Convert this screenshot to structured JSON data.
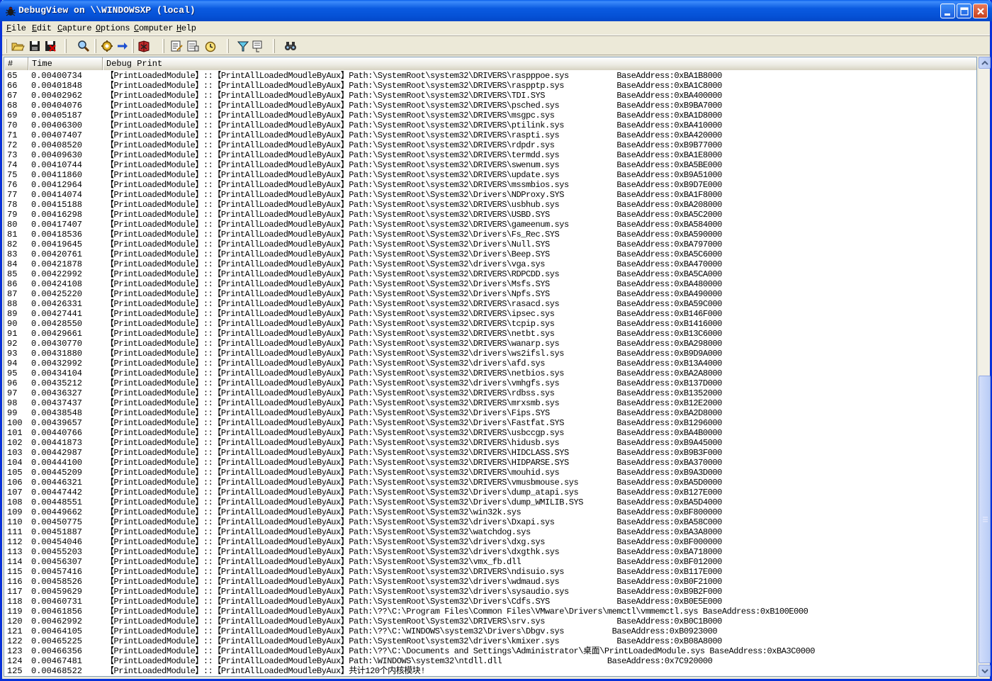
{
  "window": {
    "title": "DebugView on \\\\WINDOWSXP (local)"
  },
  "menu": {
    "items": [
      {
        "label": "File",
        "accel": "F",
        "rest": "ile"
      },
      {
        "label": "Edit",
        "accel": "E",
        "rest": "dit"
      },
      {
        "label": "Capture",
        "accel": "C",
        "rest": "apture"
      },
      {
        "label": "Options",
        "accel": "O",
        "rest": "ptions"
      },
      {
        "label": "Computer",
        "accel": "C",
        "rest": "omputer"
      },
      {
        "label": "Help",
        "accel": "H",
        "rest": "elp"
      }
    ]
  },
  "toolbar": {
    "icons": [
      "open-folder-icon",
      "save-icon",
      "save-red-icon",
      "find-icon",
      "capture-gear-icon",
      "forward-arrow-icon",
      "clear-book-icon",
      "edit-filter-icon",
      "properties-icon",
      "clock-icon",
      "filter-highlight-icon",
      "highlight-icon",
      "binoculars-icon"
    ]
  },
  "columns": {
    "num": "#",
    "time": "Time",
    "msg": "Debug Print"
  },
  "rows": [
    {
      "n": "65",
      "t": "0.00400734",
      "m": "【PrintLoadedModule】::【PrintAllLoadedMoudleByAux】Path:\\SystemRoot\\system32\\DRIVERS\\raspppoe.sys          BaseAddress:0xBA1B8000"
    },
    {
      "n": "66",
      "t": "0.00401848",
      "m": "【PrintLoadedModule】::【PrintAllLoadedMoudleByAux】Path:\\SystemRoot\\system32\\DRIVERS\\raspptp.sys           BaseAddress:0xBA1C8000"
    },
    {
      "n": "67",
      "t": "0.00402962",
      "m": "【PrintLoadedModule】::【PrintAllLoadedMoudleByAux】Path:\\SystemRoot\\system32\\DRIVERS\\TDI.SYS               BaseAddress:0xBA400000"
    },
    {
      "n": "68",
      "t": "0.00404076",
      "m": "【PrintLoadedModule】::【PrintAllLoadedMoudleByAux】Path:\\SystemRoot\\system32\\DRIVERS\\psched.sys            BaseAddress:0xB9BA7000"
    },
    {
      "n": "69",
      "t": "0.00405187",
      "m": "【PrintLoadedModule】::【PrintAllLoadedMoudleByAux】Path:\\SystemRoot\\system32\\DRIVERS\\msgpc.sys             BaseAddress:0xBA1D8000"
    },
    {
      "n": "70",
      "t": "0.00406300",
      "m": "【PrintLoadedModule】::【PrintAllLoadedMoudleByAux】Path:\\SystemRoot\\system32\\DRIVERS\\ptilink.sys           BaseAddress:0xBA410000"
    },
    {
      "n": "71",
      "t": "0.00407407",
      "m": "【PrintLoadedModule】::【PrintAllLoadedMoudleByAux】Path:\\SystemRoot\\system32\\DRIVERS\\raspti.sys            BaseAddress:0xBA420000"
    },
    {
      "n": "72",
      "t": "0.00408520",
      "m": "【PrintLoadedModule】::【PrintAllLoadedMoudleByAux】Path:\\SystemRoot\\system32\\DRIVERS\\rdpdr.sys             BaseAddress:0xB9B77000"
    },
    {
      "n": "73",
      "t": "0.00409630",
      "m": "【PrintLoadedModule】::【PrintAllLoadedMoudleByAux】Path:\\SystemRoot\\system32\\DRIVERS\\termdd.sys            BaseAddress:0xBA1E8000"
    },
    {
      "n": "74",
      "t": "0.00410744",
      "m": "【PrintLoadedModule】::【PrintAllLoadedMoudleByAux】Path:\\SystemRoot\\system32\\DRIVERS\\swenum.sys            BaseAddress:0xBA5BE000"
    },
    {
      "n": "75",
      "t": "0.00411860",
      "m": "【PrintLoadedModule】::【PrintAllLoadedMoudleByAux】Path:\\SystemRoot\\system32\\DRIVERS\\update.sys            BaseAddress:0xB9A51000"
    },
    {
      "n": "76",
      "t": "0.00412964",
      "m": "【PrintLoadedModule】::【PrintAllLoadedMoudleByAux】Path:\\SystemRoot\\system32\\DRIVERS\\mssmbios.sys          BaseAddress:0xB9D7E000"
    },
    {
      "n": "77",
      "t": "0.00414074",
      "m": "【PrintLoadedModule】::【PrintAllLoadedMoudleByAux】Path:\\SystemRoot\\System32\\Drivers\\NDProxy.SYS           BaseAddress:0xBA1F8000"
    },
    {
      "n": "78",
      "t": "0.00415188",
      "m": "【PrintLoadedModule】::【PrintAllLoadedMoudleByAux】Path:\\SystemRoot\\system32\\DRIVERS\\usbhub.sys            BaseAddress:0xBA208000"
    },
    {
      "n": "79",
      "t": "0.00416298",
      "m": "【PrintLoadedModule】::【PrintAllLoadedMoudleByAux】Path:\\SystemRoot\\system32\\DRIVERS\\USBD.SYS              BaseAddress:0xBA5C2000"
    },
    {
      "n": "80",
      "t": "0.00417407",
      "m": "【PrintLoadedModule】::【PrintAllLoadedMoudleByAux】Path:\\SystemRoot\\system32\\DRIVERS\\gameenum.sys          BaseAddress:0xBA584000"
    },
    {
      "n": "81",
      "t": "0.00418536",
      "m": "【PrintLoadedModule】::【PrintAllLoadedMoudleByAux】Path:\\SystemRoot\\System32\\Drivers\\Fs_Rec.SYS            BaseAddress:0xBA590000"
    },
    {
      "n": "82",
      "t": "0.00419645",
      "m": "【PrintLoadedModule】::【PrintAllLoadedMoudleByAux】Path:\\SystemRoot\\System32\\Drivers\\Null.SYS              BaseAddress:0xBA797000"
    },
    {
      "n": "83",
      "t": "0.00420761",
      "m": "【PrintLoadedModule】::【PrintAllLoadedMoudleByAux】Path:\\SystemRoot\\System32\\Drivers\\Beep.SYS              BaseAddress:0xBA5C6000"
    },
    {
      "n": "84",
      "t": "0.00421878",
      "m": "【PrintLoadedModule】::【PrintAllLoadedMoudleByAux】Path:\\SystemRoot\\System32\\drivers\\vga.sys               BaseAddress:0xBA470000"
    },
    {
      "n": "85",
      "t": "0.00422992",
      "m": "【PrintLoadedModule】::【PrintAllLoadedMoudleByAux】Path:\\SystemRoot\\system32\\DRIVERS\\RDPCDD.sys            BaseAddress:0xBA5CA000"
    },
    {
      "n": "86",
      "t": "0.00424108",
      "m": "【PrintLoadedModule】::【PrintAllLoadedMoudleByAux】Path:\\SystemRoot\\System32\\Drivers\\Msfs.SYS              BaseAddress:0xBA480000"
    },
    {
      "n": "87",
      "t": "0.00425220",
      "m": "【PrintLoadedModule】::【PrintAllLoadedMoudleByAux】Path:\\SystemRoot\\System32\\Drivers\\Npfs.SYS              BaseAddress:0xBA490000"
    },
    {
      "n": "88",
      "t": "0.00426331",
      "m": "【PrintLoadedModule】::【PrintAllLoadedMoudleByAux】Path:\\SystemRoot\\system32\\DRIVERS\\rasacd.sys            BaseAddress:0xBA59C000"
    },
    {
      "n": "89",
      "t": "0.00427441",
      "m": "【PrintLoadedModule】::【PrintAllLoadedMoudleByAux】Path:\\SystemRoot\\system32\\DRIVERS\\ipsec.sys             BaseAddress:0xB146F000"
    },
    {
      "n": "90",
      "t": "0.00428550",
      "m": "【PrintLoadedModule】::【PrintAllLoadedMoudleByAux】Path:\\SystemRoot\\system32\\DRIVERS\\tcpip.sys             BaseAddress:0xB1416000"
    },
    {
      "n": "91",
      "t": "0.00429661",
      "m": "【PrintLoadedModule】::【PrintAllLoadedMoudleByAux】Path:\\SystemRoot\\system32\\DRIVERS\\netbt.sys             BaseAddress:0xB13C6000"
    },
    {
      "n": "92",
      "t": "0.00430770",
      "m": "【PrintLoadedModule】::【PrintAllLoadedMoudleByAux】Path:\\SystemRoot\\system32\\DRIVERS\\wanarp.sys            BaseAddress:0xBA298000"
    },
    {
      "n": "93",
      "t": "0.00431880",
      "m": "【PrintLoadedModule】::【PrintAllLoadedMoudleByAux】Path:\\SystemRoot\\System32\\drivers\\ws2ifsl.sys           BaseAddress:0xB9D9A000"
    },
    {
      "n": "94",
      "t": "0.00432992",
      "m": "【PrintLoadedModule】::【PrintAllLoadedMoudleByAux】Path:\\SystemRoot\\System32\\drivers\\afd.sys               BaseAddress:0xB13A4000"
    },
    {
      "n": "95",
      "t": "0.00434104",
      "m": "【PrintLoadedModule】::【PrintAllLoadedMoudleByAux】Path:\\SystemRoot\\system32\\DRIVERS\\netbios.sys           BaseAddress:0xBA2A8000"
    },
    {
      "n": "96",
      "t": "0.00435212",
      "m": "【PrintLoadedModule】::【PrintAllLoadedMoudleByAux】Path:\\SystemRoot\\system32\\drivers\\vmhgfs.sys            BaseAddress:0xB137D000"
    },
    {
      "n": "97",
      "t": "0.00436327",
      "m": "【PrintLoadedModule】::【PrintAllLoadedMoudleByAux】Path:\\SystemRoot\\system32\\DRIVERS\\rdbss.sys             BaseAddress:0xB1352000"
    },
    {
      "n": "98",
      "t": "0.00437437",
      "m": "【PrintLoadedModule】::【PrintAllLoadedMoudleByAux】Path:\\SystemRoot\\system32\\DRIVERS\\mrxsmb.sys            BaseAddress:0xB12E2000"
    },
    {
      "n": "99",
      "t": "0.00438548",
      "m": "【PrintLoadedModule】::【PrintAllLoadedMoudleByAux】Path:\\SystemRoot\\System32\\Drivers\\Fips.SYS              BaseAddress:0xBA2D8000"
    },
    {
      "n": "100",
      "t": "0.00439657",
      "m": "【PrintLoadedModule】::【PrintAllLoadedMoudleByAux】Path:\\SystemRoot\\System32\\Drivers\\Fastfat.SYS           BaseAddress:0xB1296000"
    },
    {
      "n": "101",
      "t": "0.00440766",
      "m": "【PrintLoadedModule】::【PrintAllLoadedMoudleByAux】Path:\\SystemRoot\\system32\\DRIVERS\\usbccgp.sys           BaseAddress:0xBA4B0000"
    },
    {
      "n": "102",
      "t": "0.00441873",
      "m": "【PrintLoadedModule】::【PrintAllLoadedMoudleByAux】Path:\\SystemRoot\\system32\\DRIVERS\\hidusb.sys            BaseAddress:0xB9A45000"
    },
    {
      "n": "103",
      "t": "0.00442987",
      "m": "【PrintLoadedModule】::【PrintAllLoadedMoudleByAux】Path:\\SystemRoot\\system32\\DRIVERS\\HIDCLASS.SYS          BaseAddress:0xB9B3F000"
    },
    {
      "n": "104",
      "t": "0.00444100",
      "m": "【PrintLoadedModule】::【PrintAllLoadedMoudleByAux】Path:\\SystemRoot\\system32\\DRIVERS\\HIDPARSE.SYS          BaseAddress:0xBA370000"
    },
    {
      "n": "105",
      "t": "0.00445209",
      "m": "【PrintLoadedModule】::【PrintAllLoadedMoudleByAux】Path:\\SystemRoot\\system32\\DRIVERS\\mouhid.sys            BaseAddress:0xB9A3D000"
    },
    {
      "n": "106",
      "t": "0.00446321",
      "m": "【PrintLoadedModule】::【PrintAllLoadedMoudleByAux】Path:\\SystemRoot\\system32\\DRIVERS\\vmusbmouse.sys        BaseAddress:0xBA5D0000"
    },
    {
      "n": "107",
      "t": "0.00447442",
      "m": "【PrintLoadedModule】::【PrintAllLoadedMoudleByAux】Path:\\SystemRoot\\System32\\Drivers\\dump_atapi.sys        BaseAddress:0xB127E000"
    },
    {
      "n": "108",
      "t": "0.00448551",
      "m": "【PrintLoadedModule】::【PrintAllLoadedMoudleByAux】Path:\\SystemRoot\\System32\\Drivers\\dump_WMILIB.SYS       BaseAddress:0xBA5D4000"
    },
    {
      "n": "109",
      "t": "0.00449662",
      "m": "【PrintLoadedModule】::【PrintAllLoadedMoudleByAux】Path:\\SystemRoot\\System32\\win32k.sys                    BaseAddress:0xBF800000"
    },
    {
      "n": "110",
      "t": "0.00450775",
      "m": "【PrintLoadedModule】::【PrintAllLoadedMoudleByAux】Path:\\SystemRoot\\System32\\drivers\\Dxapi.sys             BaseAddress:0xBA58C000"
    },
    {
      "n": "111",
      "t": "0.00451887",
      "m": "【PrintLoadedModule】::【PrintAllLoadedMoudleByAux】Path:\\SystemRoot\\System32\\watchdog.sys                  BaseAddress:0xBA3A8000"
    },
    {
      "n": "112",
      "t": "0.00454046",
      "m": "【PrintLoadedModule】::【PrintAllLoadedMoudleByAux】Path:\\SystemRoot\\System32\\drivers\\dxg.sys               BaseAddress:0xBF000000"
    },
    {
      "n": "113",
      "t": "0.00455203",
      "m": "【PrintLoadedModule】::【PrintAllLoadedMoudleByAux】Path:\\SystemRoot\\System32\\drivers\\dxgthk.sys            BaseAddress:0xBA718000"
    },
    {
      "n": "114",
      "t": "0.00456307",
      "m": "【PrintLoadedModule】::【PrintAllLoadedMoudleByAux】Path:\\SystemRoot\\System32\\vmx_fb.dll                    BaseAddress:0xBF012000"
    },
    {
      "n": "115",
      "t": "0.00457416",
      "m": "【PrintLoadedModule】::【PrintAllLoadedMoudleByAux】Path:\\SystemRoot\\system32\\DRIVERS\\ndisuio.sys           BaseAddress:0xB117E000"
    },
    {
      "n": "116",
      "t": "0.00458526",
      "m": "【PrintLoadedModule】::【PrintAllLoadedMoudleByAux】Path:\\SystemRoot\\system32\\drivers\\wdmaud.sys            BaseAddress:0xB0F21000"
    },
    {
      "n": "117",
      "t": "0.00459629",
      "m": "【PrintLoadedModule】::【PrintAllLoadedMoudleByAux】Path:\\SystemRoot\\system32\\drivers\\sysaudio.sys          BaseAddress:0xB9B2F000"
    },
    {
      "n": "118",
      "t": "0.00460731",
      "m": "【PrintLoadedModule】::【PrintAllLoadedMoudleByAux】Path:\\SystemRoot\\System32\\Drivers\\Cdfs.SYS              BaseAddress:0xB0E5E000"
    },
    {
      "n": "119",
      "t": "0.00461856",
      "m": "【PrintLoadedModule】::【PrintAllLoadedMoudleByAux】Path:\\??\\C:\\Program Files\\Common Files\\VMware\\Drivers\\memctl\\vmmemctl.sys BaseAddress:0xB100E000"
    },
    {
      "n": "120",
      "t": "0.00462992",
      "m": "【PrintLoadedModule】::【PrintAllLoadedMoudleByAux】Path:\\SystemRoot\\System32\\DRIVERS\\srv.sys               BaseAddress:0xB0C1B000"
    },
    {
      "n": "121",
      "t": "0.00464105",
      "m": "【PrintLoadedModule】::【PrintAllLoadedMoudleByAux】Path:\\??\\C:\\WINDOWS\\system32\\Drivers\\Dbgv.sys          BaseAddress:0xB0923000"
    },
    {
      "n": "122",
      "t": "0.00465225",
      "m": "【PrintLoadedModule】::【PrintAllLoadedMoudleByAux】Path:\\SystemRoot\\system32\\drivers\\kmixer.sys            BaseAddress:0xB08A8000"
    },
    {
      "n": "123",
      "t": "0.00466356",
      "m": "【PrintLoadedModule】::【PrintAllLoadedMoudleByAux】Path:\\??\\C:\\Documents and Settings\\Administrator\\桌面\\PrintLoadedModule.sys BaseAddress:0xBA3C0000"
    },
    {
      "n": "124",
      "t": "0.00467481",
      "m": "【PrintLoadedModule】::【PrintAllLoadedMoudleByAux】Path:\\WINDOWS\\system32\\ntdll.dll                      BaseAddress:0x7C920000"
    },
    {
      "n": "125",
      "t": "0.00468522",
      "m": "【PrintLoadedModule】::【PrintAllLoadedMoudleByAux】共计120个内核模块!"
    }
  ]
}
